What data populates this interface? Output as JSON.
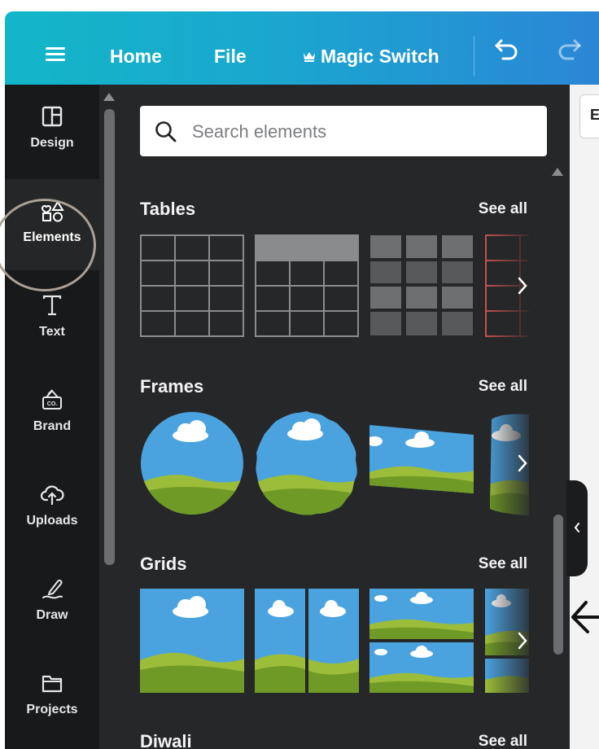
{
  "topbar": {
    "nav": [
      {
        "label": "Home"
      },
      {
        "label": "File"
      },
      {
        "label": "Magic Switch"
      }
    ],
    "icons": [
      "menu-icon",
      "crown-icon",
      "undo-icon",
      "redo-icon"
    ]
  },
  "rail": {
    "items": [
      {
        "label": "Design",
        "icon": "layout-icon"
      },
      {
        "label": "Elements",
        "icon": "shapes-icon",
        "selected": true
      },
      {
        "label": "Text",
        "icon": "text-icon"
      },
      {
        "label": "Brand",
        "icon": "brand-icon"
      },
      {
        "label": "Uploads",
        "icon": "cloud-upload-icon"
      },
      {
        "label": "Draw",
        "icon": "pen-icon"
      },
      {
        "label": "Projects",
        "icon": "folder-icon"
      }
    ]
  },
  "search": {
    "placeholder": "Search elements"
  },
  "sections": [
    {
      "title": "Tables",
      "see_all": "See all"
    },
    {
      "title": "Frames",
      "see_all": "See all"
    },
    {
      "title": "Grids",
      "see_all": "See all"
    },
    {
      "title": "Diwali",
      "see_all": "See all"
    }
  ],
  "editor": {
    "chip_label": "E"
  },
  "colors": {
    "topbar_start": "#13b6c8",
    "topbar_end": "#2b86d6",
    "panel_bg": "#262729",
    "rail_bg": "#18191b",
    "sky": "#4aa3df",
    "grass": "#7aa12e",
    "table_red": "#c85050"
  }
}
